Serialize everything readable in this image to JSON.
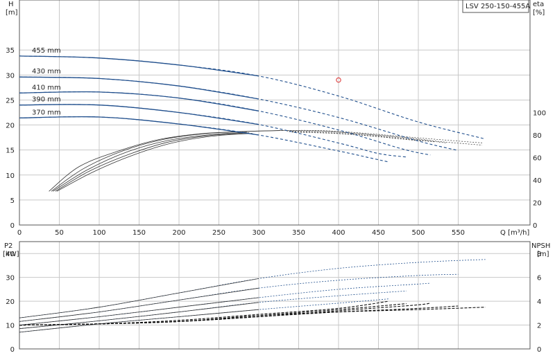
{
  "model": "LSV 250-150-455A",
  "chart_data": [
    {
      "type": "line",
      "panel": "head-efficiency",
      "xlabel": "Q [m³/h]",
      "ylabel_left": [
        "H",
        "[m]"
      ],
      "ylabel_right": [
        "eta",
        "[%]"
      ],
      "x_ticks": [
        0,
        50,
        100,
        150,
        200,
        250,
        300,
        350,
        400,
        450,
        500,
        550
      ],
      "y_ticks_left": [
        0,
        5,
        10,
        15,
        20,
        25,
        30,
        35
      ],
      "y_ticks_right": [
        0,
        20,
        40,
        60,
        80,
        100
      ],
      "xlim": [
        0,
        640
      ],
      "ylim_left": [
        0,
        45
      ],
      "ylim_right": [
        0,
        200
      ],
      "grid": true,
      "head_curves": [
        {
          "label": "455 mm",
          "x": [
            0,
            100,
            200,
            300,
            400,
            500,
            584
          ],
          "y": [
            33.8,
            33.4,
            32.0,
            29.8,
            25.8,
            20.6,
            17.2
          ]
        },
        {
          "label": "430 mm",
          "x": [
            0,
            100,
            200,
            300,
            400,
            500,
            550
          ],
          "y": [
            29.6,
            29.3,
            27.8,
            25.2,
            21.5,
            16.8,
            14.9
          ]
        },
        {
          "label": "410 mm",
          "x": [
            0,
            100,
            200,
            300,
            400,
            480,
            515
          ],
          "y": [
            26.4,
            26.6,
            25.4,
            22.8,
            19.0,
            15.2,
            14.0
          ]
        },
        {
          "label": "390 mm",
          "x": [
            0,
            100,
            200,
            300,
            400,
            450,
            485
          ],
          "y": [
            24.0,
            24.0,
            22.5,
            20.1,
            16.4,
            14.3,
            13.6
          ]
        },
        {
          "label": "370 mm",
          "x": [
            0,
            100,
            200,
            300,
            400,
            440,
            463
          ],
          "y": [
            21.4,
            21.6,
            20.2,
            18.0,
            14.8,
            13.4,
            12.6
          ]
        }
      ],
      "efficiency_curves": [
        {
          "x": [
            37,
            75,
            125,
            175,
            225,
            275,
            325,
            375,
            425,
            475,
            525,
            580
          ],
          "y": [
            30,
            52,
            66,
            76,
            81,
            83,
            84,
            84,
            82,
            79,
            76,
            73
          ]
        },
        {
          "x": [
            40,
            80,
            130,
            180,
            230,
            280,
            330,
            380,
            430,
            480,
            530,
            580
          ],
          "y": [
            30,
            50,
            66,
            76,
            81,
            83,
            84,
            83.5,
            81,
            78,
            74,
            71
          ]
        },
        {
          "x": [
            42,
            85,
            135,
            185,
            235,
            285,
            335,
            385,
            435,
            485,
            535
          ],
          "y": [
            30,
            49,
            65,
            75,
            80,
            82.5,
            83.5,
            83,
            80.5,
            77,
            73
          ]
        },
        {
          "x": [
            45,
            88,
            138,
            188,
            238,
            288,
            338,
            388,
            438,
            488,
            520
          ],
          "y": [
            30,
            48,
            63,
            74,
            79.5,
            82,
            83,
            82,
            79.5,
            76,
            74
          ]
        },
        {
          "x": [
            47,
            92,
            142,
            192,
            242,
            292,
            342,
            392,
            442,
            492,
            505
          ],
          "y": [
            30,
            47,
            62,
            73,
            79,
            81.5,
            82.5,
            81.5,
            79,
            75.5,
            74.5
          ]
        }
      ],
      "marker": {
        "x": 400,
        "y": 29
      }
    },
    {
      "type": "line",
      "panel": "power-npsh",
      "xlabel": "",
      "ylabel_left": [
        "P2",
        "[kW]"
      ],
      "ylabel_right": [
        "NPSH",
        "[m]"
      ],
      "y_ticks_left": [
        0,
        10,
        20,
        30,
        40
      ],
      "y_ticks_right": [
        0,
        2,
        4,
        6,
        8
      ],
      "ylim_left": [
        0,
        45
      ],
      "ylim_right": [
        0,
        9
      ],
      "grid": true,
      "power_curves": [
        {
          "x": [
            0,
            100,
            200,
            300,
            400,
            500,
            584
          ],
          "y": [
            13.0,
            17.5,
            23.5,
            29.5,
            33.8,
            36.3,
            37.5
          ]
        },
        {
          "x": [
            0,
            100,
            200,
            300,
            400,
            500,
            550
          ],
          "y": [
            11.5,
            15.5,
            20.5,
            25.5,
            28.8,
            30.8,
            31.3
          ]
        },
        {
          "x": [
            0,
            100,
            200,
            300,
            400,
            500,
            515
          ],
          "y": [
            10.0,
            13.5,
            17.5,
            21.5,
            25.0,
            27.2,
            27.6
          ]
        },
        {
          "x": [
            0,
            100,
            200,
            300,
            400,
            485
          ],
          "y": [
            8.5,
            11.8,
            15.5,
            19.5,
            22.3,
            24.3
          ]
        },
        {
          "x": [
            0,
            100,
            200,
            300,
            400,
            463
          ],
          "y": [
            7.0,
            10.5,
            13.5,
            16.5,
            19.2,
            21.0
          ]
        }
      ],
      "npsh_curves": [
        {
          "x": [
            0,
            100,
            200,
            300,
            400,
            500,
            584
          ],
          "y": [
            2.0,
            2.1,
            2.3,
            2.8,
            3.1,
            3.3,
            3.5
          ]
        },
        {
          "x": [
            0,
            100,
            200,
            300,
            400,
            500,
            550
          ],
          "y": [
            2.0,
            2.1,
            2.3,
            2.7,
            3.1,
            3.4,
            3.6
          ]
        },
        {
          "x": [
            0,
            100,
            200,
            300,
            400,
            500,
            515
          ],
          "y": [
            2.0,
            2.1,
            2.3,
            2.7,
            3.2,
            3.7,
            3.9
          ]
        },
        {
          "x": [
            0,
            100,
            200,
            300,
            400,
            485
          ],
          "y": [
            2.0,
            2.1,
            2.3,
            2.8,
            3.3,
            3.8
          ]
        },
        {
          "x": [
            0,
            100,
            200,
            300,
            400,
            463
          ],
          "y": [
            2.0,
            2.1,
            2.4,
            2.9,
            3.4,
            4.0
          ]
        }
      ]
    }
  ]
}
